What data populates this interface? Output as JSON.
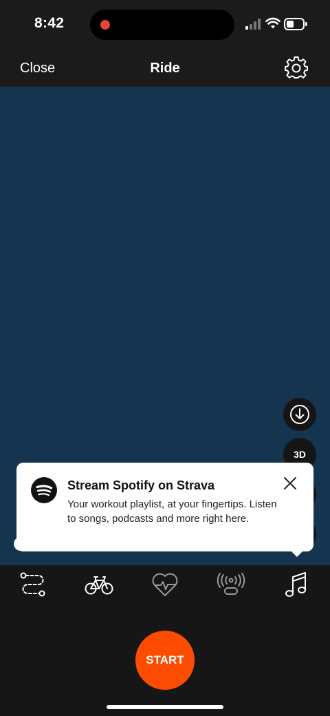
{
  "status_bar": {
    "time": "8:42",
    "recording_color": "#e5453a"
  },
  "nav": {
    "close_label": "Close",
    "title": "Ride",
    "settings_icon": "gear-icon"
  },
  "map": {
    "background_color": "#15344f",
    "controls": {
      "download_icon": "download-circle-icon",
      "view_3d_label": "3D"
    }
  },
  "tooltip": {
    "icon": "spotify-icon",
    "title": "Stream Spotify on Strava",
    "body": "Your workout playlist, at your fingertips. Listen to songs, podcasts and more right here.",
    "close_icon": "close-icon"
  },
  "tabs": [
    {
      "name": "route",
      "icon": "route-icon"
    },
    {
      "name": "sport",
      "icon": "bike-icon"
    },
    {
      "name": "heart-rate",
      "icon": "heart-rate-icon"
    },
    {
      "name": "sensors",
      "icon": "sensor-icon"
    },
    {
      "name": "music",
      "icon": "music-note-icon"
    }
  ],
  "start": {
    "label": "START",
    "color": "#fc4c02"
  }
}
